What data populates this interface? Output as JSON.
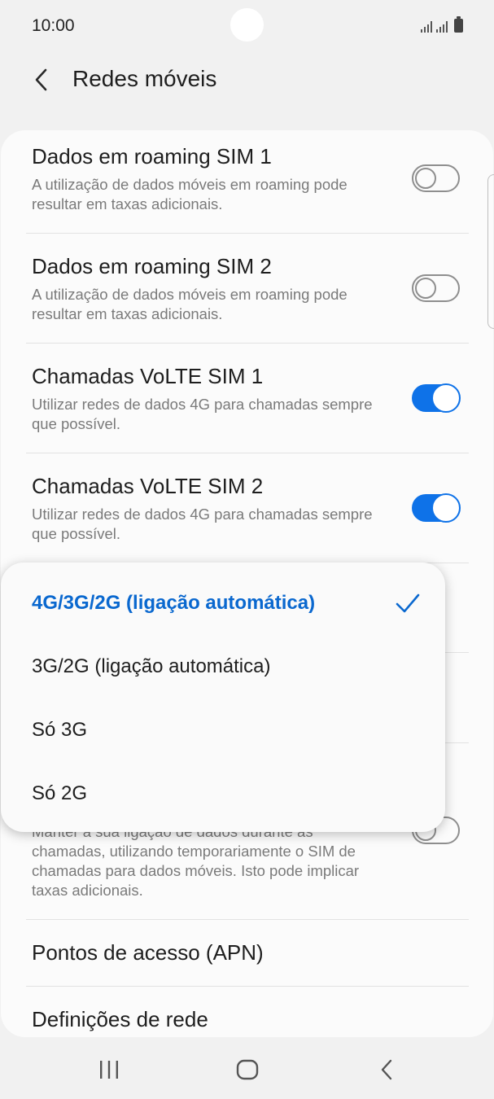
{
  "status_bar": {
    "time": "10:00",
    "icons": [
      "signal-sim1-icon",
      "signal-sim2-icon",
      "battery-icon"
    ]
  },
  "app_bar": {
    "back_icon": "chevron-left-icon",
    "title": "Redes móveis"
  },
  "settings": [
    {
      "title": "Dados em roaming SIM 1",
      "description": "A utilização de dados móveis em roaming pode resultar em taxas adicionais.",
      "toggle_on": false
    },
    {
      "title": "Dados em roaming SIM 2",
      "description": "A utilização de dados móveis em roaming pode resultar em taxas adicionais.",
      "toggle_on": false
    },
    {
      "title": "Chamadas VoLTE SIM 1",
      "description": "Utilizar redes de dados 4G para chamadas sempre que possível.",
      "toggle_on": true
    },
    {
      "title": "Chamadas VoLTE SIM 2",
      "description": "Utilizar redes de dados 4G para chamadas sempre que possível.",
      "toggle_on": true
    },
    {
      "title": "",
      "description": "Manter a sua ligação de dados durante as chamadas, utilizando temporariamente o SIM de chamadas para dados móveis. Isto pode implicar taxas adicionais.",
      "toggle_on": false
    },
    {
      "title": "Pontos de acesso (APN)"
    },
    {
      "title": "Definições de rede"
    }
  ],
  "network_mode_menu": {
    "options": [
      "4G/3G/2G (ligação automática)",
      "3G/2G (ligação automática)",
      "Só 3G",
      "Só 2G"
    ],
    "selected": "4G/3G/2G (ligação automática)",
    "selected_icon": "checkmark-icon"
  },
  "nav_bar": {
    "items": [
      "recent-apps-icon",
      "home-icon",
      "back-icon"
    ]
  },
  "colors": {
    "accent": "#0e72e8",
    "selected_text": "#0a68cf",
    "background": "#f1f1f1",
    "card": "#fbfbfb"
  }
}
